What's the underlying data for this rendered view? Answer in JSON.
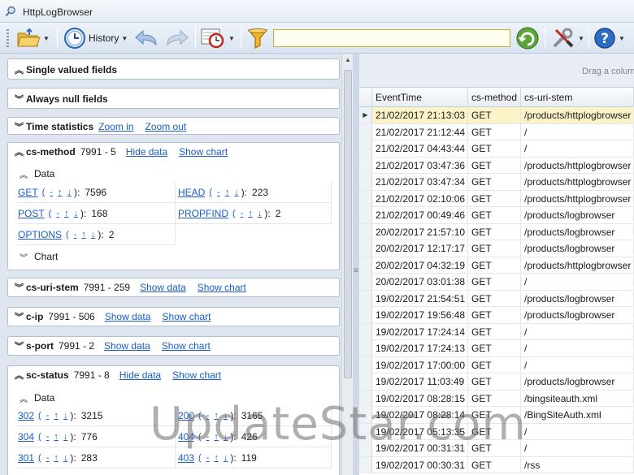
{
  "window": {
    "title": "HttpLogBrowser"
  },
  "toolbar": {
    "history_label": "History",
    "search_value": ""
  },
  "left": {
    "single_valued": {
      "title": "Single valued fields"
    },
    "always_null": {
      "title": "Always null fields"
    },
    "time_stats": {
      "title": "Time statistics",
      "zoom_in": "Zoom in",
      "zoom_out": "Zoom out"
    },
    "cs_method": {
      "title": "cs-method",
      "count": "7991 - 5",
      "hide_data": "Hide data",
      "show_chart": "Show chart",
      "data_label": "Data",
      "chart_label": "Chart",
      "items": [
        {
          "name": "GET",
          "value": "7596"
        },
        {
          "name": "HEAD",
          "value": "223"
        },
        {
          "name": "POST",
          "value": "168"
        },
        {
          "name": "PROPFIND",
          "value": "2"
        },
        {
          "name": "OPTIONS",
          "value": "2"
        }
      ]
    },
    "cs_uri_stem": {
      "title": "cs-uri-stem",
      "count": "7991 - 259",
      "show_data": "Show data",
      "show_chart": "Show chart"
    },
    "c_ip": {
      "title": "c-ip",
      "count": "7991 - 506",
      "show_data": "Show data",
      "show_chart": "Show chart"
    },
    "s_port": {
      "title": "s-port",
      "count": "7991 - 2",
      "show_data": "Show data",
      "show_chart": "Show chart"
    },
    "sc_status": {
      "title": "sc-status",
      "count": "7991 - 8",
      "hide_data": "Hide data",
      "show_chart": "Show chart",
      "data_label": "Data",
      "items": [
        {
          "name": "302",
          "value": "3215"
        },
        {
          "name": "200",
          "value": "3165"
        },
        {
          "name": "304",
          "value": "776"
        },
        {
          "name": "404",
          "value": "426"
        },
        {
          "name": "301",
          "value": "283"
        },
        {
          "name": "403",
          "value": "119"
        }
      ]
    },
    "ops": {
      "minus": "-",
      "up": "↑",
      "down": "↓",
      "open": "(",
      "close": "):"
    }
  },
  "grid": {
    "drag_hint": "Drag a colum",
    "columns": [
      "EventTime",
      "cs-method",
      "cs-uri-stem"
    ],
    "rows": [
      [
        "21/02/2017 21:13:03",
        "GET",
        "/products/httplogbrowser"
      ],
      [
        "21/02/2017 21:12:44",
        "GET",
        "/"
      ],
      [
        "21/02/2017 04:43:44",
        "GET",
        "/"
      ],
      [
        "21/02/2017 03:47:36",
        "GET",
        "/products/httplogbrowser"
      ],
      [
        "21/02/2017 03:47:34",
        "GET",
        "/products/httplogbrowser"
      ],
      [
        "21/02/2017 02:10:06",
        "GET",
        "/products/httplogbrowser"
      ],
      [
        "21/02/2017 00:49:46",
        "GET",
        "/products/logbrowser"
      ],
      [
        "20/02/2017 21:57:10",
        "GET",
        "/products/logbrowser"
      ],
      [
        "20/02/2017 12:17:17",
        "GET",
        "/products/logbrowser"
      ],
      [
        "20/02/2017 04:32:19",
        "GET",
        "/products/httplogbrowser"
      ],
      [
        "20/02/2017 03:01:38",
        "GET",
        "/"
      ],
      [
        "19/02/2017 21:54:51",
        "GET",
        "/products/logbrowser"
      ],
      [
        "19/02/2017 19:56:48",
        "GET",
        "/products/logbrowser"
      ],
      [
        "19/02/2017 17:24:14",
        "GET",
        "/"
      ],
      [
        "19/02/2017 17:24:13",
        "GET",
        "/"
      ],
      [
        "19/02/2017 17:00:00",
        "GET",
        "/"
      ],
      [
        "19/02/2017 11:03:49",
        "GET",
        "/products/logbrowser"
      ],
      [
        "19/02/2017 08:28:15",
        "GET",
        "/bingsiteauth.xml"
      ],
      [
        "19/02/2017 08:28:14",
        "GET",
        "/BingSiteAuth.xml"
      ],
      [
        "19/02/2017 05:13:35",
        "GET",
        "/"
      ],
      [
        "19/02/2017 00:31:31",
        "GET",
        "/"
      ],
      [
        "19/02/2017 00:30:31",
        "GET",
        "/rss"
      ]
    ]
  },
  "watermark": "UpdateStar.com"
}
